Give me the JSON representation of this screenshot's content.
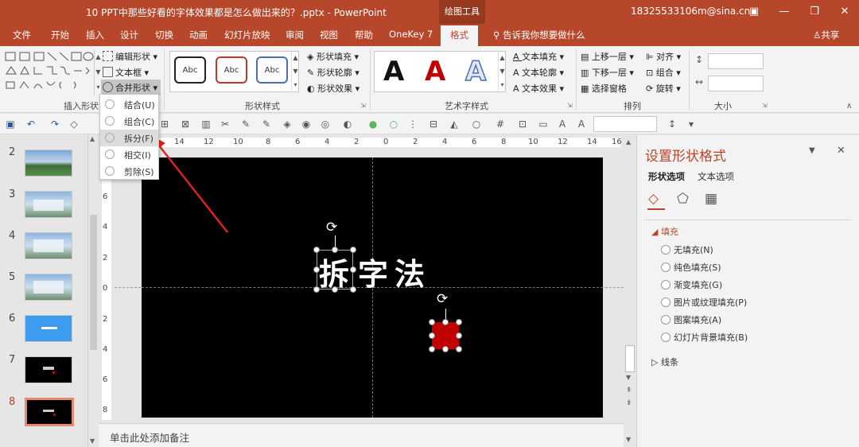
{
  "window": {
    "title": "10 PPT中那些好看的字体效果都是怎么做出来的？.pptx  -  PowerPoint",
    "context_tab": "绘图工具",
    "account": "18325533106m@sina.cn"
  },
  "ribbon_tabs": [
    "文件",
    "开始",
    "插入",
    "设计",
    "切换",
    "动画",
    "幻灯片放映",
    "审阅",
    "视图",
    "帮助",
    "OneKey 7",
    "格式"
  ],
  "tell_me": "告诉我你想要做什么",
  "share": "共享",
  "ribbon": {
    "insert_shapes": {
      "edit_shape": "编辑形状",
      "text_box": "文本框",
      "merge_shapes": "合并形状",
      "label": "插入形状"
    },
    "shape_styles": {
      "samples": [
        "Abc",
        "Abc",
        "Abc"
      ],
      "fill": "形状填充",
      "outline": "形状轮廓",
      "effects": "形状效果",
      "label": "形状样式"
    },
    "wordart": {
      "samples": [
        "A",
        "A",
        "A"
      ],
      "text_fill": "文本填充",
      "text_outline": "文本轮廓",
      "text_effects": "文本效果",
      "label": "艺术字样式"
    },
    "arrange": {
      "bring_forward": "上移一层",
      "send_backward": "下移一层",
      "selection_pane": "选择窗格",
      "align": "对齐",
      "group": "组合",
      "rotate": "旋转",
      "label": "排列"
    },
    "size": {
      "label": "大小"
    }
  },
  "merge_menu": [
    "结合(U)",
    "组合(C)",
    "拆分(F)",
    "相交(I)",
    "剪除(S)"
  ],
  "ruler": {
    "h_labels": [
      "14",
      "12",
      "10",
      "8",
      "6",
      "4",
      "2",
      "0",
      "2",
      "4",
      "6",
      "8",
      "10",
      "12",
      "14",
      "16"
    ],
    "v_labels": [
      "8",
      "6",
      "4",
      "2",
      "0",
      "2",
      "4",
      "6",
      "8"
    ]
  },
  "thumbnails": [
    "2",
    "3",
    "4",
    "5",
    "6",
    "7",
    "8"
  ],
  "selected_slide": "8",
  "slide": {
    "chars": [
      "拆",
      "字",
      "法"
    ]
  },
  "notes_placeholder": "单击此处添加备注",
  "format_pane": {
    "title": "设置形状格式",
    "tabs": [
      "形状选项",
      "文本选项"
    ],
    "fill_section": "填充",
    "fill_options": [
      "无填充(N)",
      "纯色填充(S)",
      "渐变填充(G)",
      "图片或纹理填充(P)",
      "图案填充(A)",
      "幻灯片背景填充(B)"
    ],
    "line_section": "线条"
  },
  "colors": {
    "accent": "#b7472a",
    "shape_red": "#c00000"
  }
}
